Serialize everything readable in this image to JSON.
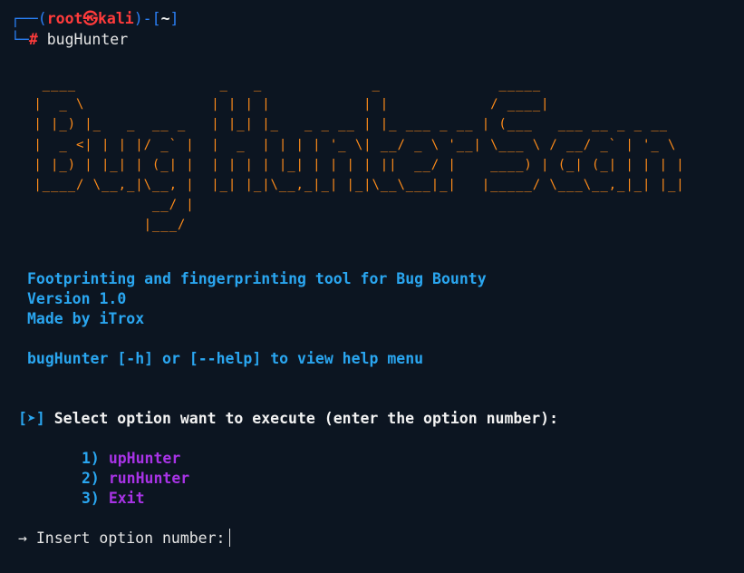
{
  "prompt": {
    "corner_top": "┌──(",
    "user": "root",
    "skull": "㉿",
    "host": "kali",
    "mid": ")-[",
    "dir": "~",
    "close": "]",
    "corner_bottom": "└─",
    "hash": "#",
    "command": "bugHunter"
  },
  "banner": {
    "ascii": [
      "  ____                 _   _             _              _____                   ",
      " |  _ \\               | | | |           | |            / ____|                  ",
      " | |_) |_   _  __ _   | |_| |_   _ _ __ | |_ ___ _ __ | (___   ___ __ _ _ __    ",
      " |  _ <| | | |/ _` |  |  _  | | | | '_ \\| __/ _ \\ '__| \\___ \\ / __/ _` | '_ \\   ",
      " | |_) | |_| | (_| |  | | | | |_| | | | | ||  __/ |    ____) | (_| (_| | | | |  ",
      " |____/ \\__,_|\\__, |  |_| |_|\\__,_|_| |_|\\__\\___|_|   |_____/ \\___\\__,_|_| |_|  ",
      "               __/ |                                                            ",
      "              |___/                                                             "
    ]
  },
  "info": {
    "line1": "Footprinting and fingerprinting tool for Bug Bounty",
    "line2": "Version 1.0",
    "line3": "Made by iTrox",
    "help": "bugHunter [-h] or [--help] to view help menu"
  },
  "menu": {
    "marker": "[➤]",
    "heading": "Select option want to execute (enter the option number):",
    "options": [
      {
        "num": "1)",
        "label": "upHunter"
      },
      {
        "num": "2)",
        "label": "runHunter"
      },
      {
        "num": "3)",
        "label": "Exit"
      }
    ]
  },
  "input": {
    "arrow": "→",
    "label": "Insert option number:",
    "value": ""
  },
  "colors": {
    "background": "#0c1521",
    "prompt_blue": "#2a7ff5",
    "root_red": "#ff3b3b",
    "banner_orange": "#ff8c1a",
    "info_blue": "#2aa6f0",
    "option_purple": "#a833e6"
  }
}
